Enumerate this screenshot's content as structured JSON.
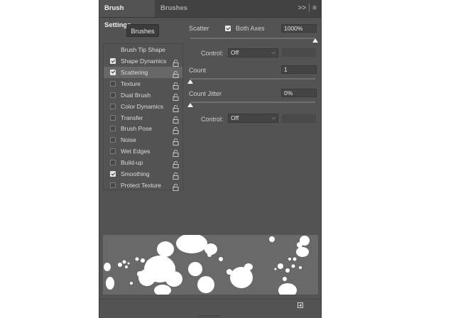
{
  "tabs": {
    "brush_settings": "Brush Settings",
    "brushes": "Brushes"
  },
  "tab_menu": {
    "collapse": ">>",
    "menu": "≡"
  },
  "brushes_button": "Brushes",
  "options": {
    "title": "Brush Tip Shape",
    "items": [
      {
        "label": "Shape Dynamics",
        "checked": true
      },
      {
        "label": "Scattering",
        "checked": true,
        "selected": true
      },
      {
        "label": "Texture",
        "checked": false
      },
      {
        "label": "Dual Brush",
        "checked": false
      },
      {
        "label": "Color Dynamics",
        "checked": false
      },
      {
        "label": "Transfer",
        "checked": false
      },
      {
        "label": "Brush Pose",
        "checked": false
      },
      {
        "label": "Noise",
        "checked": false
      },
      {
        "label": "Wet Edges",
        "checked": false
      },
      {
        "label": "Build-up",
        "checked": false
      },
      {
        "label": "Smoothing",
        "checked": true
      },
      {
        "label": "Protect Texture",
        "checked": false
      }
    ]
  },
  "scatter": {
    "label": "Scatter",
    "both_axes_label": "Both Axes",
    "both_axes_checked": true,
    "value": "1000%",
    "slider_fraction": 1.0
  },
  "control1": {
    "label": "Control:",
    "value": "Off"
  },
  "count": {
    "label": "Count",
    "value": "1",
    "slider_fraction": 0.0
  },
  "count_jitter": {
    "label": "Count Jitter",
    "value": "0%",
    "slider_fraction": 0.0
  },
  "control2": {
    "label": "Control:",
    "value": "Off"
  },
  "icons": {
    "lock": "lock-icon",
    "chevron": "chevron-down-icon",
    "new_preset": "new-preset-icon"
  }
}
